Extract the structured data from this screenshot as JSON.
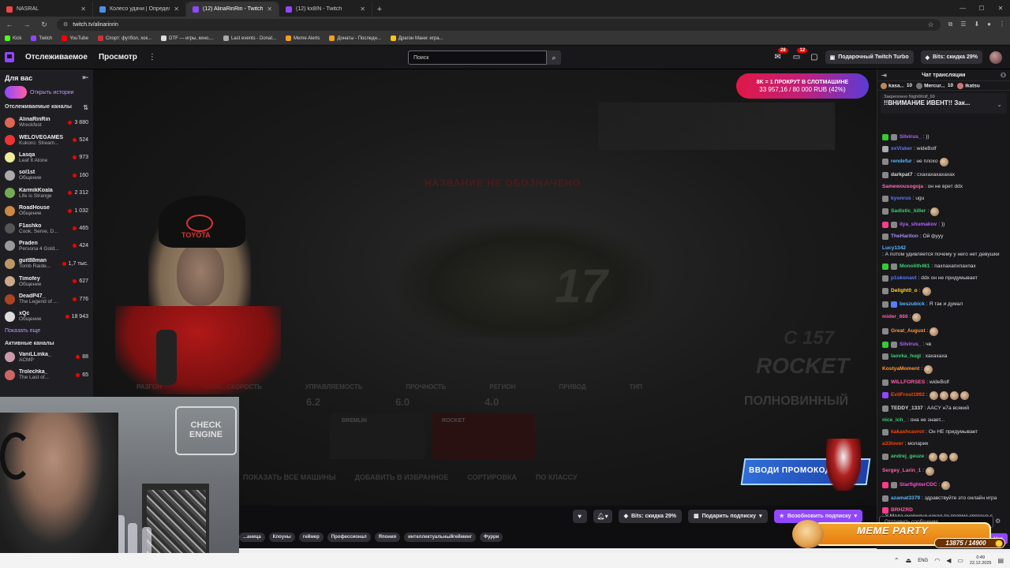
{
  "browser": {
    "tabs": [
      {
        "title": "NASRAL",
        "color": "#e44"
      },
      {
        "title": "Колесо удачи | Определите п",
        "color": "#4a90e2"
      },
      {
        "title": "(12) AlinaRinRin - Twitch",
        "color": "#9147ff"
      },
      {
        "title": "(12) kx8IN - Twitch",
        "color": "#9147ff"
      }
    ],
    "url": "twitch.tv/alinarinrin",
    "bookmarks": [
      {
        "label": "Kick",
        "color": "#53fc18"
      },
      {
        "label": "Twitch",
        "color": "#9147ff"
      },
      {
        "label": "YouTube",
        "color": "#ff0000"
      },
      {
        "label": "Спорт: футбол, хок...",
        "color": "#c33"
      },
      {
        "label": "DTF — игры, кино,...",
        "color": "#ddd"
      },
      {
        "label": "Last events - Donat...",
        "color": "#aaa"
      },
      {
        "label": "Meme Alerts",
        "color": "#f0a020"
      },
      {
        "label": "Донаты - Последн...",
        "color": "#f0a020"
      },
      {
        "label": "Драгон Мани: игра...",
        "color": "#f5c518"
      }
    ]
  },
  "topnav": {
    "following": "Отслеживаемое",
    "browse": "Просмотр",
    "more": "⋮",
    "search_placeholder": "Поиск",
    "notif_badge": "28",
    "inbox_badge": "12",
    "turbo": "Подарочный Twitch Turbo",
    "bits_discount": "Bits: скидка 29%"
  },
  "sidebar": {
    "title": "Для вас",
    "stories": "Открыть истории",
    "followed_title": "Отслеживаемые каналы",
    "channels": [
      {
        "name": "AlinaRinRin",
        "game": "Wreckfest",
        "viewers": "3 880",
        "color": "#d65"
      },
      {
        "name": "WELOVEGAMES",
        "game": "Kukoro: Stream...",
        "viewers": "524",
        "color": "#e33"
      },
      {
        "name": "Lasqa",
        "game": "Leaf It Alone",
        "viewers": "973",
        "color": "#ee9"
      },
      {
        "name": "sol1st",
        "game": "Общение",
        "viewers": "160",
        "color": "#aaa"
      },
      {
        "name": "KarmikKoala",
        "game": "Life is Strange",
        "viewers": "2 312",
        "color": "#7a5"
      },
      {
        "name": "RoadHouse",
        "game": "Общение",
        "viewers": "1 032",
        "color": "#c84"
      },
      {
        "name": "F1ashko",
        "game": "Cook, Serve, D...",
        "viewers": "465",
        "color": "#555"
      },
      {
        "name": "Praden",
        "game": "Persona 4 Gold...",
        "viewers": "424",
        "color": "#999"
      },
      {
        "name": "guit88man",
        "game": "Tomb Raide...",
        "viewers": "1,7 тыс.",
        "color": "#b96"
      },
      {
        "name": "Timofey",
        "game": "Общение",
        "viewers": "627",
        "color": "#ca8"
      },
      {
        "name": "DeadP47_",
        "game": "The Legend of ...",
        "viewers": "776",
        "color": "#a42"
      },
      {
        "name": "xQc",
        "game": "Общение",
        "viewers": "18 943",
        "color": "#ddd"
      }
    ],
    "show_more": "Показать еще",
    "active_title": "Активные каналы",
    "active": [
      {
        "name": "VaniLLinka_",
        "game": "ACMP",
        "viewers": "88",
        "color": "#c9a"
      },
      {
        "name": "Trolechka_",
        "game": "The Last of...",
        "viewers": "65",
        "color": "#c66"
      }
    ]
  },
  "video": {
    "promo_line1": "8K = 1 ПРОКРУТ В СЛОТМАШИНЕ",
    "promo_line2": "33 957,16 / 80 000 RUB (42%)",
    "promo_progress": 0.42,
    "promo2_text": "ВВОДИ ПРОМОКОД",
    "car_number": "17",
    "game_title": "НАЗВАНИЕ НЕ ОБОЗНАЧЕНО",
    "car_name": "ROCKET",
    "car_code": "C 157",
    "stats": [
      "РАЗГОН",
      "МАКС. СКОРОСТЬ",
      "УПРАВЛЯЕМОСТЬ",
      "ПРОЧНОСТЬ",
      "РЕГИОН",
      "ПРИВОД",
      "ТИП"
    ],
    "stat_values": [
      "6.2",
      "6.0",
      "4.0"
    ],
    "car_type": "ПОЛНОВИННЫЙ",
    "mini1": "BREMLIN",
    "mini2": "ROCKET",
    "bottom_opts": [
      "ПОКАЗАТЬ ВСЕ МАШИНЫ",
      "ДОБАВИТЬ В ИЗБРАННОЕ",
      "СОРТИРОВКА",
      "ПО КЛАССУ"
    ],
    "cap_text": "TOYOTA",
    "webcam_sign": "CHECK ENGINE"
  },
  "controls": {
    "bits": "Bits: скидка 29%",
    "gift": "Подарить подписку",
    "resub": "Возобновить подписку"
  },
  "tags": [
    "...аница",
    "Клоуны",
    "геймер",
    "Профессионал",
    "Япония",
    "интеллектуальныйгейминг",
    "Фурри"
  ],
  "chat": {
    "title": "Чат трансляции",
    "leaders": [
      {
        "name": "kasa...",
        "count": "10",
        "color": "#b85"
      },
      {
        "name": "Mercur...",
        "count": "10",
        "color": "#777"
      },
      {
        "name": "ikatsu",
        "count": "",
        "color": "#c77"
      }
    ],
    "pinned_by": "Закреплено NightWolf_69",
    "pinned_msg": "!!ВНИМАНИЕ ИВЕНТ!! Зак...",
    "messages": [
      {
        "user": "Silvirus_",
        "color": "#b362ff",
        "text": ": ))",
        "badges": [
          "#3c3",
          "#888"
        ]
      },
      {
        "user": "xxVisker",
        "color": "#5a7cff",
        "text": ": wideBolf",
        "badges": [
          "#aaa"
        ]
      },
      {
        "user": "rendefur",
        "color": "#5ab4ff",
        "text": ": не плохо",
        "badges": [
          "#888"
        ],
        "emote": 1
      },
      {
        "user": "darkpat7",
        "color": "#d9d9d9",
        "text": ": схахахахахахах",
        "badges": [
          "#888"
        ]
      },
      {
        "user": "Samewousogoja",
        "color": "#ff69b4",
        "text": ": он не врет ddx",
        "badges": []
      },
      {
        "user": "kyonrus",
        "color": "#5a7cff",
        "text": ": ugu",
        "badges": [
          "#888"
        ]
      },
      {
        "user": "Sadistic_killer",
        "color": "#3cd070",
        "text": ":",
        "badges": [
          "#888"
        ],
        "emote": 1
      },
      {
        "user": "ilya_shumakov",
        "color": "#b362ff",
        "text": ": ))",
        "badges": [
          "#ff3c8c",
          "#888"
        ]
      },
      {
        "user": "TheHariton",
        "color": "#a58cff",
        "text": ": Ой фууу",
        "badges": [
          "#888"
        ]
      },
      {
        "user": "Lucy1342",
        "color": "#5ab4ff",
        "text": ": А потом удивляется почему у него нет девушки",
        "badges": []
      },
      {
        "user": "Monolith461",
        "color": "#3cd070",
        "text": ": пахпахапхпахпах",
        "badges": [
          "#3c3",
          "#888"
        ]
      },
      {
        "user": "p1skonavt",
        "color": "#5a7cff",
        "text": ": ddx он не придумывает",
        "badges": [
          "#888"
        ]
      },
      {
        "user": "Delight0_o",
        "color": "#ffd23f",
        "text": ":",
        "badges": [
          "#888"
        ],
        "emote": 1
      },
      {
        "user": "beszubick",
        "color": "#5ab4ff",
        "text": ": Я так и думал",
        "badges": [
          "#888",
          "#5a7cff"
        ]
      },
      {
        "user": "mider_666",
        "color": "#ff5ea4",
        "text": ":",
        "badges": [],
        "emote": 1
      },
      {
        "user": "Great_August",
        "color": "#ff9933",
        "text": ":",
        "badges": [
          "#888"
        ],
        "emote": 1
      },
      {
        "user": "Silvirus_",
        "color": "#b362ff",
        "text": ": чв",
        "badges": [
          "#3c3",
          "#888"
        ]
      },
      {
        "user": "laovka_hugi",
        "color": "#3cd070",
        "text": ": хахахаха",
        "badges": [
          "#888"
        ]
      },
      {
        "user": "KostyaMoment",
        "color": "#ff9933",
        "text": ":",
        "badges": [],
        "emote": 1
      },
      {
        "user": "WILLFORSES",
        "color": "#ff5ea4",
        "text": ": wideBolf",
        "badges": [
          "#888"
        ]
      },
      {
        "user": "EvilFrost1992",
        "color": "#ff4500",
        "text": ":",
        "badges": [
          "#9147ff"
        ],
        "emote": 4
      },
      {
        "user": "TEDDY_1337",
        "color": "#d9d9d9",
        "text": ": AACY н7а всякий",
        "badges": [
          "#888"
        ]
      },
      {
        "user": "nice_ich_",
        "color": "#3cd070",
        "text": ": она не знает...",
        "badges": []
      },
      {
        "user": "kakashcavrot",
        "color": "#ff4500",
        "text": ": Он НЕ придумывает",
        "badges": [
          "#888"
        ]
      },
      {
        "user": "a33lover",
        "color": "#ff4500",
        "text": ": моларик",
        "badges": []
      },
      {
        "user": "andrej_geuze",
        "color": "#3cd070",
        "text": ":",
        "badges": [
          "#888"
        ],
        "emote": 3
      },
      {
        "user": "Sergey_Larin_1",
        "color": "#ff5ea4",
        "text": ":",
        "badges": [],
        "emote": 1
      },
      {
        "user": "StarfighterCDC",
        "color": "#ff4dd2",
        "text": ":",
        "badges": [
          "#ff3c8c",
          "#888"
        ],
        "emote": 1
      },
      {
        "user": "azamat3379",
        "color": "#5ab4ff",
        "text": ": здравствуйте это онлайн игра",
        "badges": [
          "#888"
        ]
      },
      {
        "user": "BRHZRD",
        "color": "#ff5ea4",
        "text": ": У Мада очевидно какая-то травма связана с женщинами",
        "badges": [
          "#ff3c8c"
        ]
      }
    ],
    "input_placeholder": "Отправить сообщение",
    "send_label": "Чат"
  },
  "meme_party": {
    "title": "MEME PARTY",
    "count": "13875 / 14900",
    "progress": 0.93
  },
  "taskbar": {
    "lang": "ENG",
    "time": "0:49",
    "date": "22.12.2025"
  }
}
